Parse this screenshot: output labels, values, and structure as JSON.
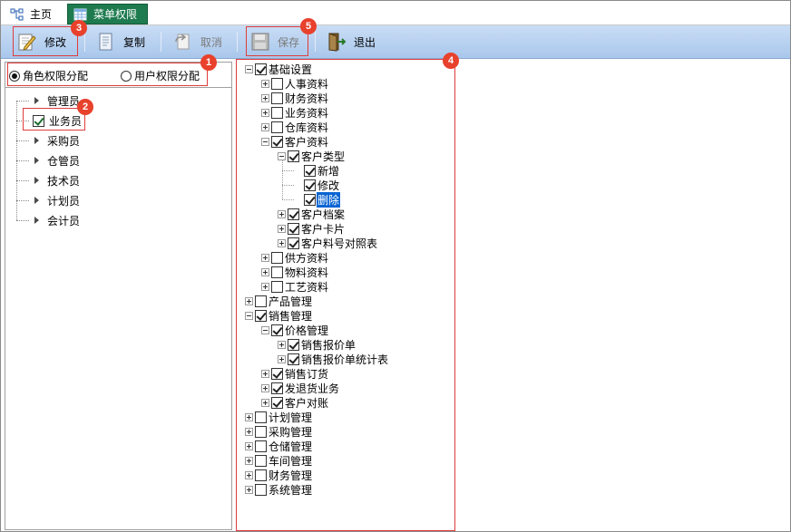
{
  "tabs": {
    "home": "主页",
    "active": "菜单权限"
  },
  "toolbar": {
    "edit": "修改",
    "copy": "复制",
    "cancel": "取消",
    "save": "保存",
    "exit": "退出"
  },
  "markers": [
    "1",
    "2",
    "3",
    "4",
    "5"
  ],
  "assign": {
    "role_option": "角色权限分配",
    "user_option": "用户权限分配",
    "selected": "role"
  },
  "roles": [
    {
      "label": "管理员",
      "checked": false
    },
    {
      "label": "业务员",
      "checked": true
    },
    {
      "label": "采购员",
      "checked": false
    },
    {
      "label": "仓管员",
      "checked": false
    },
    {
      "label": "技术员",
      "checked": false
    },
    {
      "label": "计划员",
      "checked": false
    },
    {
      "label": "会计员",
      "checked": false
    }
  ],
  "tree": [
    {
      "label": "基础设置",
      "level": 0,
      "checked": true,
      "expand": "minus"
    },
    {
      "label": "人事资料",
      "level": 1,
      "checked": false,
      "expand": "plus"
    },
    {
      "label": "财务资料",
      "level": 1,
      "checked": false,
      "expand": "plus"
    },
    {
      "label": "业务资料",
      "level": 1,
      "checked": false,
      "expand": "plus"
    },
    {
      "label": "仓库资料",
      "level": 1,
      "checked": false,
      "expand": "plus"
    },
    {
      "label": "客户资料",
      "level": 1,
      "checked": true,
      "expand": "minus"
    },
    {
      "label": "客户类型",
      "level": 2,
      "checked": true,
      "expand": "minus"
    },
    {
      "label": "新增",
      "level": 3,
      "checked": true,
      "expand": "none"
    },
    {
      "label": "修改",
      "level": 3,
      "checked": true,
      "expand": "none"
    },
    {
      "label": "删除",
      "level": 3,
      "checked": true,
      "expand": "none",
      "selected": true
    },
    {
      "label": "客户档案",
      "level": 2,
      "checked": true,
      "expand": "plus"
    },
    {
      "label": "客户卡片",
      "level": 2,
      "checked": true,
      "expand": "plus"
    },
    {
      "label": "客户料号对照表",
      "level": 2,
      "checked": true,
      "expand": "plus"
    },
    {
      "label": "供方资料",
      "level": 1,
      "checked": false,
      "expand": "plus"
    },
    {
      "label": "物料资料",
      "level": 1,
      "checked": false,
      "expand": "plus"
    },
    {
      "label": "工艺资料",
      "level": 1,
      "checked": false,
      "expand": "plus"
    },
    {
      "label": "产品管理",
      "level": 0,
      "checked": false,
      "expand": "plus"
    },
    {
      "label": "销售管理",
      "level": 0,
      "checked": true,
      "expand": "minus"
    },
    {
      "label": "价格管理",
      "level": 1,
      "checked": true,
      "expand": "minus"
    },
    {
      "label": "销售报价单",
      "level": 2,
      "checked": true,
      "expand": "plus"
    },
    {
      "label": "销售报价单统计表",
      "level": 2,
      "checked": true,
      "expand": "plus"
    },
    {
      "label": "销售订货",
      "level": 1,
      "checked": true,
      "expand": "plus"
    },
    {
      "label": "发退货业务",
      "level": 1,
      "checked": true,
      "expand": "plus"
    },
    {
      "label": "客户对账",
      "level": 1,
      "checked": true,
      "expand": "plus"
    },
    {
      "label": "计划管理",
      "level": 0,
      "checked": false,
      "expand": "plus"
    },
    {
      "label": "采购管理",
      "level": 0,
      "checked": false,
      "expand": "plus"
    },
    {
      "label": "仓储管理",
      "level": 0,
      "checked": false,
      "expand": "plus"
    },
    {
      "label": "车间管理",
      "level": 0,
      "checked": false,
      "expand": "plus"
    },
    {
      "label": "财务管理",
      "level": 0,
      "checked": false,
      "expand": "plus"
    },
    {
      "label": "系统管理",
      "level": 0,
      "checked": false,
      "expand": "plus"
    }
  ]
}
